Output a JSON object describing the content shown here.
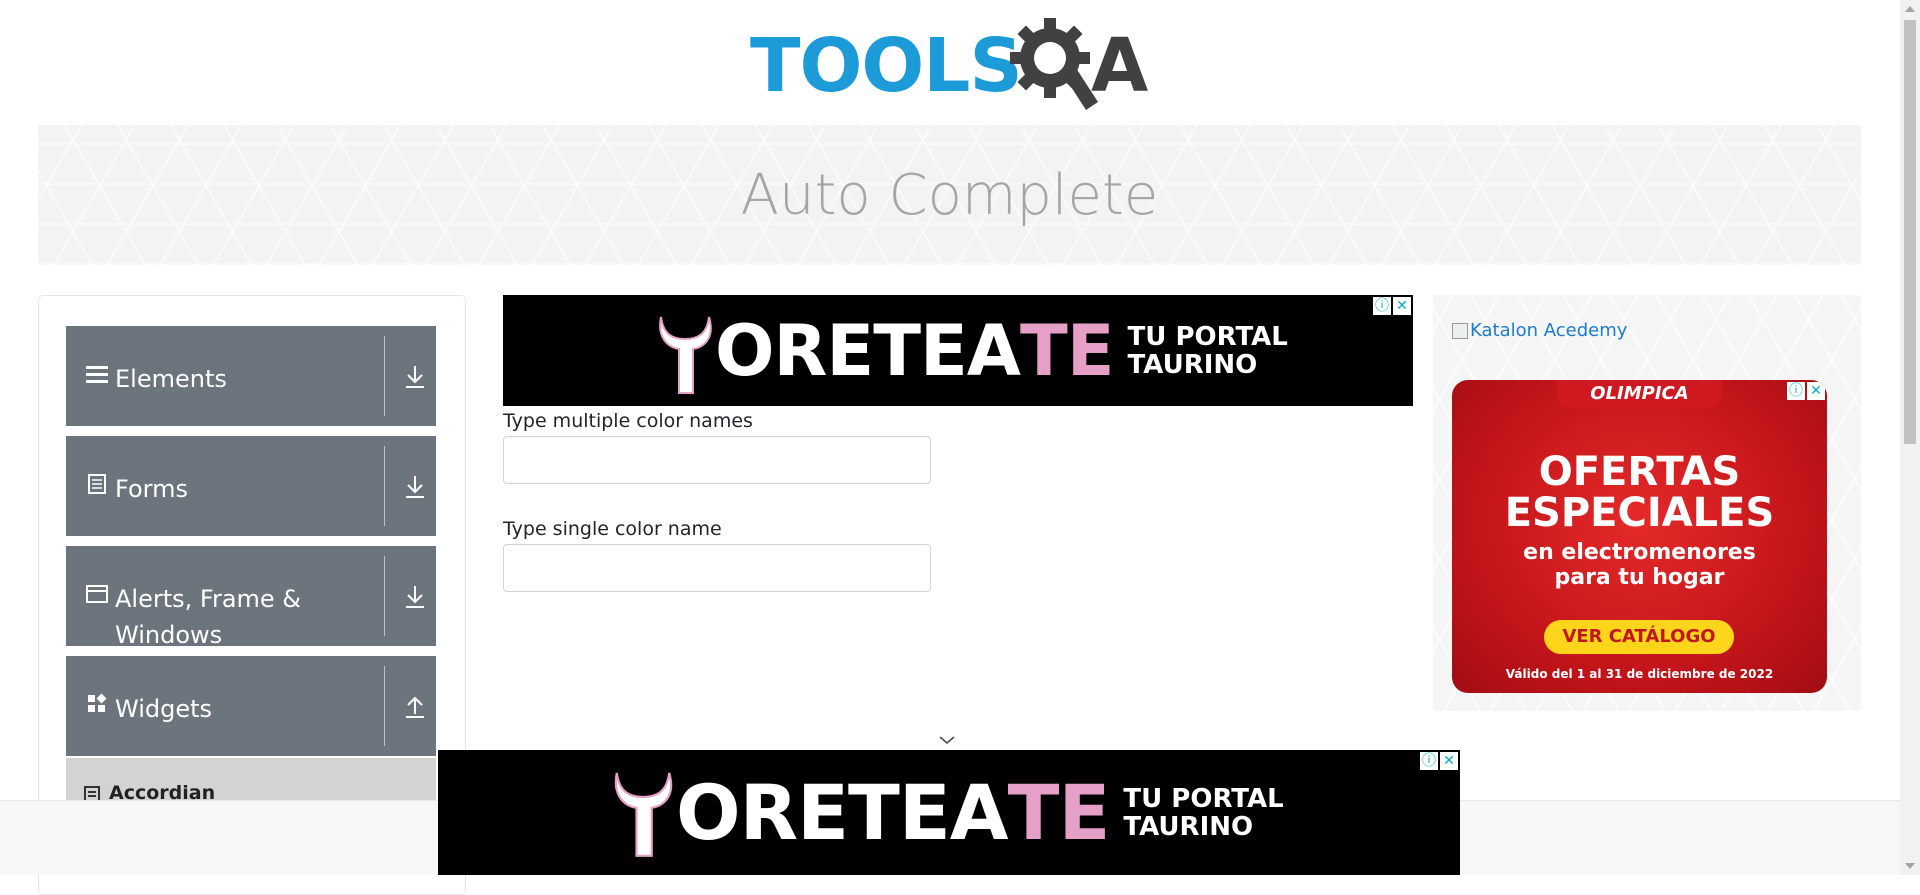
{
  "header": {
    "logo_text_left": "TOOLS",
    "logo_text_right": "A",
    "brand_color": "#1c9bd8"
  },
  "banner": {
    "title": "Auto Complete"
  },
  "sidebar": {
    "groups": [
      {
        "label": "Elements",
        "icon": "hamburger-icon",
        "arrow": "download-arrow-icon"
      },
      {
        "label": "Forms",
        "icon": "document-icon",
        "arrow": "download-arrow-icon"
      },
      {
        "label": "Alerts, Frame &",
        "label2": "Windows",
        "icon": "window-icon",
        "arrow": "download-arrow-icon"
      },
      {
        "label": "Widgets",
        "icon": "widgets-icon",
        "arrow": "upload-arrow-icon"
      }
    ],
    "active_item": {
      "label": "Accordian",
      "icon": "accordion-icon"
    }
  },
  "ads": {
    "top_banner": {
      "word_white": "ORETEA",
      "word_pink": "TE",
      "line1": "TU PORTAL",
      "line2": "TAURINO"
    },
    "bottom_banner": {
      "word_white": "ORETEA",
      "word_pink": "TE",
      "line1": "TU PORTAL",
      "line2": "TAURINO"
    },
    "side": {
      "katalon_alt": "Katalon Acedemy",
      "brand": "OLIMPICA",
      "headline1": "OFERTAS",
      "headline2": "ESPECIALES",
      "line3": "en electromenores",
      "line4": "para tu hogar",
      "cta": "VER CATÁLOGO",
      "validity": "Válido del 1 al 31 de diciembre de 2022"
    }
  },
  "form": {
    "multiple_label": "Type multiple color names",
    "multiple_value": "",
    "single_label": "Type single color name",
    "single_value": ""
  }
}
